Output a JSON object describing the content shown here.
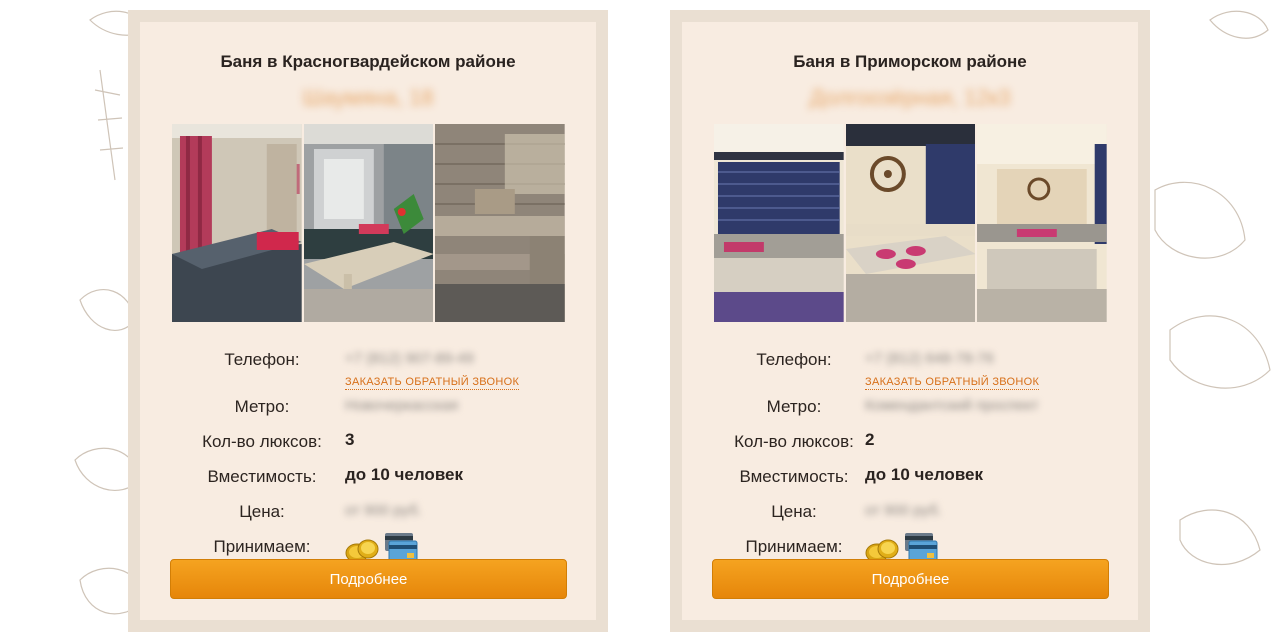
{
  "cards": [
    {
      "title": "Баня в Красногвардейском районе",
      "address": "Шаумяна, 18",
      "phone_label": "Телефон:",
      "phone_value": "+7 (812) 907-89-49",
      "callback_label": "ЗАКАЗАТЬ ОБРАТНЫЙ ЗВОНОК",
      "metro_label": "Метро:",
      "metro_value": "Новочеркасская",
      "suites_label": "Кол-во люксов:",
      "suites_value": "3",
      "capacity_label": "Вместимость:",
      "capacity_value": "до 10 человек",
      "price_label": "Цена:",
      "price_value": "от 900 руб.",
      "payment_label": "Принимаем:",
      "payment_icons": [
        "coins-icon",
        "credit-card-icon"
      ],
      "button_label": "Подробнее"
    },
    {
      "title": "Баня в Приморском районе",
      "address": "Долгоозёрная, 12к3",
      "phone_label": "Телефон:",
      "phone_value": "+7 (812) 648-78-76",
      "callback_label": "ЗАКАЗАТЬ ОБРАТНЫЙ ЗВОНОК",
      "metro_label": "Метро:",
      "metro_value": "Комендантский проспект",
      "suites_label": "Кол-во люксов:",
      "suites_value": "2",
      "capacity_label": "Вместимость:",
      "capacity_value": "до 10 человек",
      "price_label": "Цена:",
      "price_value": "от 900 руб.",
      "payment_label": "Принимаем:",
      "payment_icons": [
        "coins-icon",
        "credit-card-icon"
      ],
      "button_label": "Подробнее"
    }
  ],
  "colors": {
    "card_border": "#eadfd2",
    "card_bg": "#f8ece1",
    "accent": "#d7701a",
    "button": "#ef9614"
  }
}
